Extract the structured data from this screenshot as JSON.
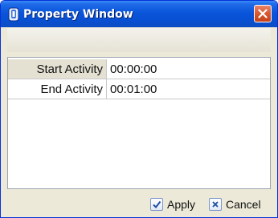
{
  "window": {
    "title": "Property Window",
    "title_icon": "app-icon",
    "close_icon": "close-icon"
  },
  "properties": [
    {
      "name": "Start Activity",
      "value": "00:00:00"
    },
    {
      "name": "End Activity",
      "value": "00:01:00"
    }
  ],
  "buttons": {
    "apply_label": "Apply",
    "apply_icon": "checkmark-icon",
    "cancel_label": "Cancel",
    "cancel_icon": "x-icon"
  },
  "colors": {
    "titlebar": "#0a55db",
    "close_button": "#d9582f",
    "window_background": "#ece9d8"
  }
}
